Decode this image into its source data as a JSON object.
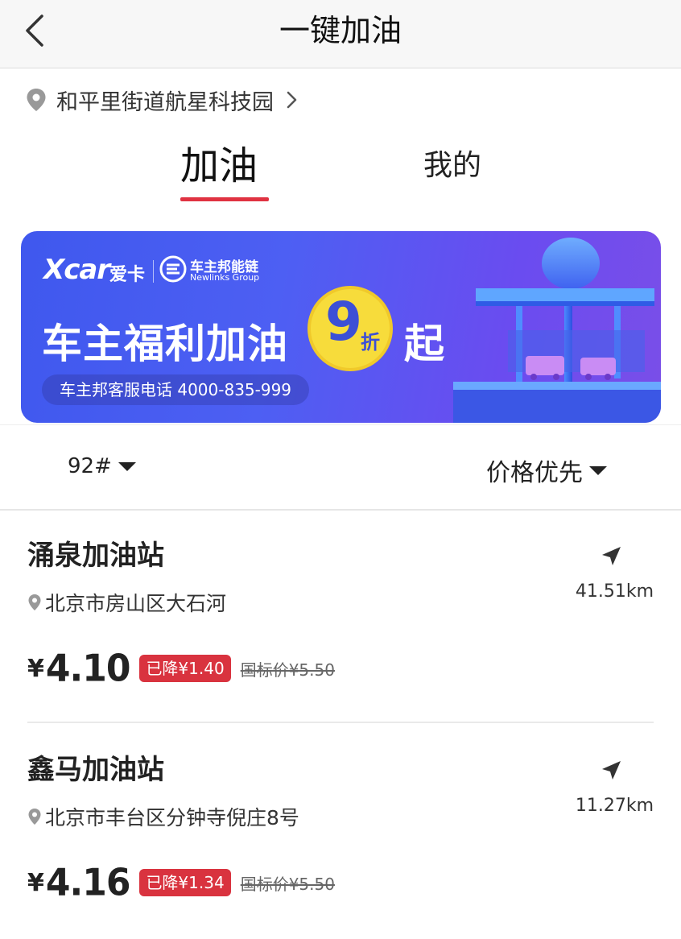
{
  "nav": {
    "title": "一键加油"
  },
  "location": {
    "text": "和平里街道航星科技园"
  },
  "tabs": [
    {
      "label": "加油",
      "active": true
    },
    {
      "label": "我的",
      "active": false
    }
  ],
  "banner": {
    "brand_x": "Xcar",
    "brand_ika": "爱卡",
    "partner_cn": "车主邦能链",
    "partner_en": "Newlinks Group",
    "headline": "车主福利加油",
    "discount_num": "9",
    "discount_unit": "折",
    "suffix": "起",
    "phone": "车主邦客服电话 4000-835-999",
    "accent": "#f7dc3b"
  },
  "filters": {
    "fuel_grade": "92#",
    "sort": "价格优先"
  },
  "stations": [
    {
      "name": "涌泉加油站",
      "address": "北京市房山区大石河",
      "distance": "41.51km",
      "currency": "¥",
      "price": "4.10",
      "discount": "已降¥1.40",
      "original": "国标价¥5.50"
    },
    {
      "name": "鑫马加油站",
      "address": "北京市丰台区分钟寺倪庄8号",
      "distance": "11.27km",
      "currency": "¥",
      "price": "4.16",
      "discount": "已降¥1.34",
      "original": "国标价¥5.50"
    }
  ],
  "colors": {
    "accent_red": "#d9333f",
    "tab_underline": "#e03241"
  }
}
